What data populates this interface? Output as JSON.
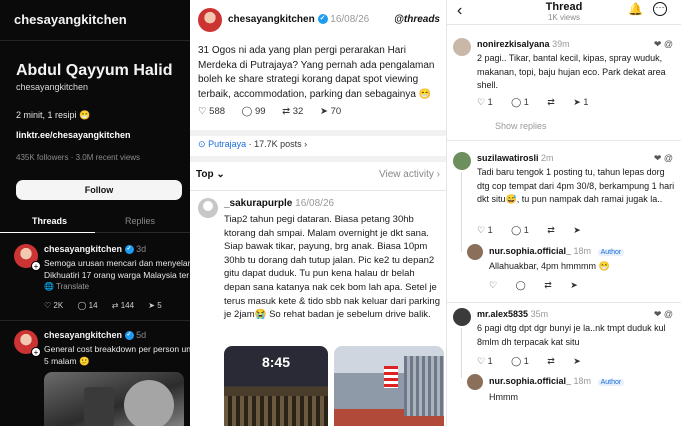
{
  "left_profile": {
    "handle_top": "chesayangkitchen",
    "display_name": "Abdul Qayyum Halid",
    "handle": "chesayangkitchen",
    "bio": "2 minit, 1 resipi 😁",
    "link": "linktr.ee/chesayangkitchen",
    "followers": "435K followers · 3.0M recent views",
    "follow_label": "Follow",
    "tabs": [
      "Threads",
      "Replies"
    ],
    "posts": [
      {
        "author": "chesayangkitchen",
        "time": "3d",
        "lines": [
          "Semoga urusan mencari dan menyelar",
          "Dikhuatiri 17 orang warga Malaysia ter"
        ],
        "translate": "Translate",
        "stats": [
          "2K",
          "14",
          "144",
          "5"
        ]
      },
      {
        "author": "chesayangkitchen",
        "time": "5d",
        "lines": [
          "General cost breakdown per person un",
          "5 malam 🙂"
        ]
      }
    ]
  },
  "main_post": {
    "author": "chesayangkitchen",
    "date": "16/08/26",
    "brand": "threads",
    "body": "31 Ogos ni ada yang plan pergi perarakan Hari Merdeka di Putrajaya? Yang pernah ada pengalaman boleh ke share strategi korang dapat spot viewing terbaik, accommodation, parking dan sebagainya 😁",
    "stats": {
      "likes": "588",
      "comments": "99",
      "reposts": "32",
      "shares": "70"
    },
    "location": "Putrajaya",
    "location_meta": "· 17.7K posts",
    "sort": "Top",
    "view_activity": "View activity",
    "comment": {
      "author": "_sakurapurple",
      "date": "16/08/26",
      "text": "Tiap2 tahun pegi dataran. Biasa petang 30hb ktorang dah smpai. Malam overnight je dkt sana. Siap bawak tikar, payung, brg anak. Biasa 10pm 30hb tu dorang dah tutup jalan. Pic ke2 tu depan2 gitu dapat duduk. Tu pun kena halau dr belah depan sana katanya nak cek bom lah apa. Setel je terus masuk kete & tido sbb nak keluar dari parking je 2jam😭 So rehat badan je sebelum drive balik.",
      "photo_time": "8:45"
    }
  },
  "thread": {
    "title": "Thread",
    "views": "1K views",
    "comments": [
      {
        "author": "nonirezkisalyana",
        "time": "39m",
        "text": "2 pagi.. Tikar, bantal kecil, kipas, spray wuduk, makanan, topi, baju hujan eco. Park dekat area shell.",
        "actions": [
          "1",
          "1",
          "",
          "1"
        ],
        "show_replies": "Show replies"
      },
      {
        "author": "suzilawatirosli",
        "time": "2m",
        "text": "Tadi baru tengok 1 posting tu, tahun lepas dorg dtg cop tempat dari 4pm 30/8, berkampung 1 hari dkt situ😅, tu pun nampak dah ramai jugak la..",
        "actions": [
          "1",
          "1",
          "",
          ""
        ],
        "reply": {
          "author": "nur.sophia.official_",
          "time": "18m",
          "badge": "Author",
          "text": "Allahuakbar, 4pm hmmmm 😁",
          "actions": [
            "",
            "",
            "",
            ""
          ]
        }
      },
      {
        "author": "mr.alex5835",
        "time": "35m",
        "text": "6 pagi dtg dpt dgr bunyi je la..nk tmpt duduk kul 8mlm dh terpacak kat situ",
        "actions": [
          "1",
          "1",
          "",
          ""
        ],
        "reply": {
          "author": "nur.sophia.official_",
          "time": "18m",
          "badge": "Author",
          "text": "Hmmm"
        }
      }
    ]
  }
}
